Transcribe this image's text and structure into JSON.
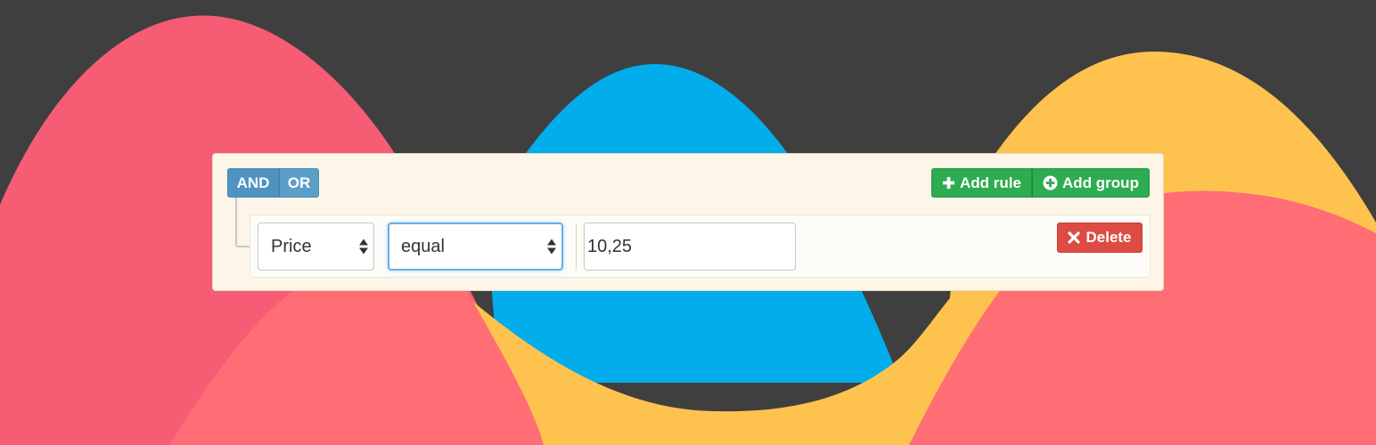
{
  "conditions": {
    "and_label": "AND",
    "or_label": "OR",
    "active": "AND"
  },
  "actions": {
    "add_rule_label": "Add rule",
    "add_group_label": "Add group"
  },
  "rule": {
    "field_value": "Price",
    "operator_value": "equal",
    "input_value": "10,25",
    "delete_label": "Delete"
  },
  "icons": {
    "add_rule": "plus-icon",
    "add_group": "plus-circle-icon",
    "delete": "close-icon"
  },
  "colors": {
    "background": "#3f3f3f",
    "wave_red": "#f75c75",
    "wave_salmon": "#ff6e74",
    "wave_blue": "#02adeb",
    "wave_yellow": "#fec34f",
    "panel": "#fcf5e8",
    "btn_primary": "#5b9fc8",
    "btn_success": "#2eac51",
    "btn_danger": "#dd4b44"
  }
}
